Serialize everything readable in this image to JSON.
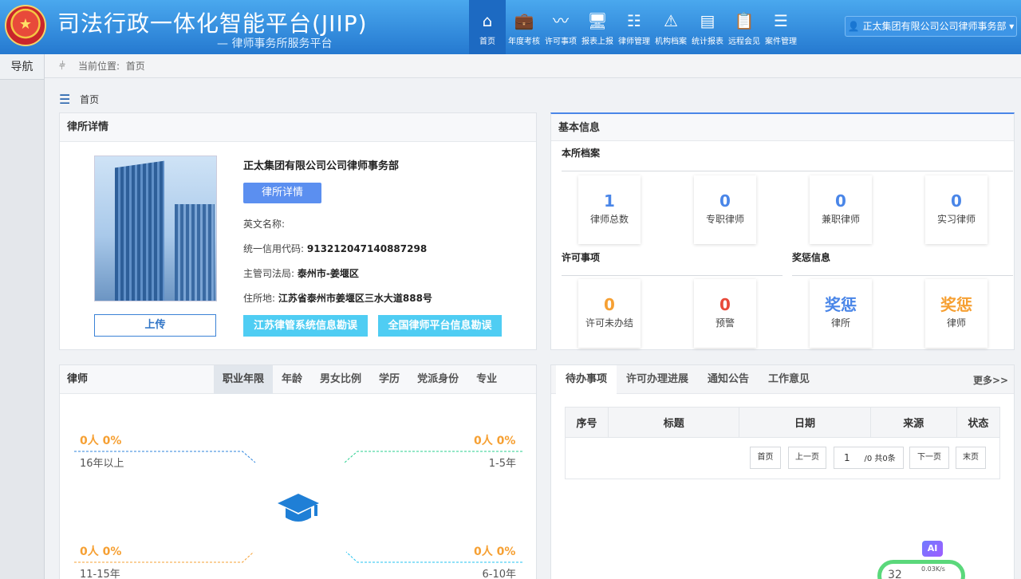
{
  "header": {
    "title": "司法行政一体化智能平台(JIIP)",
    "subtitle": "—  律师事务所服务平台",
    "nav": [
      {
        "label": "首页",
        "icon": "home-icon",
        "glyph": "⌂",
        "active": true
      },
      {
        "label": "年度考核",
        "icon": "briefcase-icon",
        "glyph": "💼"
      },
      {
        "label": "许可事项",
        "icon": "pulse-icon",
        "glyph": "〰"
      },
      {
        "label": "报表上报",
        "icon": "upload-screen-icon",
        "glyph": "🖥"
      },
      {
        "label": "律师管理",
        "icon": "org-chart-icon",
        "glyph": "☷"
      },
      {
        "label": "机构档案",
        "icon": "warning-icon",
        "glyph": "⚠"
      },
      {
        "label": "统计报表",
        "icon": "report-icon",
        "glyph": "▤"
      },
      {
        "label": "远程会见",
        "icon": "clipboard-icon",
        "glyph": "📋"
      },
      {
        "label": "案件管理",
        "icon": "list-user-icon",
        "glyph": "☰"
      }
    ],
    "user": "正太集团有限公司公司律师事务部"
  },
  "sidebar": {
    "title": "导航"
  },
  "breadcrumb": {
    "label": "当前位置:",
    "current": "首页"
  },
  "page_title": "首页",
  "firm_card": {
    "title": "律所详情",
    "name": "正太集团有限公司公司律师事务部",
    "detail_button": "律所详情",
    "english_name_label": "英文名称:",
    "english_name": "",
    "credit_code_label": "统一信用代码:",
    "credit_code": "913212047140887298",
    "bureau_label": "主管司法局:",
    "bureau": "泰州市-姜堰区",
    "address_label": "住所地:",
    "address": "江苏省泰州市姜堰区三水大道888号",
    "upload_button": "上传",
    "btn_js": "江苏律管系统信息勘误",
    "btn_nat": "全国律师平台信息勘误"
  },
  "basic_card": {
    "title": "基本信息",
    "archive_label": "本所档案",
    "archive_stats": [
      {
        "value": "1",
        "label": "律师总数"
      },
      {
        "value": "0",
        "label": "专职律师"
      },
      {
        "value": "0",
        "label": "兼职律师"
      },
      {
        "value": "0",
        "label": "实习律师"
      }
    ],
    "permit_label": "许可事项",
    "permit_stats": [
      {
        "value": "0",
        "label": "许可未办结",
        "color": "#f6a033"
      },
      {
        "value": "0",
        "label": "预警",
        "color": "#e84a3a"
      }
    ],
    "award_label": "奖惩信息",
    "award_stats": [
      {
        "value": "奖惩",
        "label": "律所",
        "color": "#4a86e8"
      },
      {
        "value": "奖惩",
        "label": "律师",
        "color": "#f6a033"
      }
    ]
  },
  "lawyer_card": {
    "title": "律师",
    "tabs": [
      "职业年限",
      "年龄",
      "男女比例",
      "学历",
      "党派身份",
      "专业"
    ],
    "active_tab": 0,
    "center_icon": "graduation-cap-icon"
  },
  "chart_data": {
    "type": "pie",
    "categories": [
      "1-5年",
      "6-10年",
      "11-15年",
      "16年以上"
    ],
    "values": [
      0,
      0,
      0,
      0
    ],
    "value_labels": [
      "0人 0%",
      "0人 0%",
      "0人 0%",
      "0人 0%"
    ],
    "colors": [
      "#27cf8f",
      "#21c3f0",
      "#f6a033",
      "#2f86de"
    ]
  },
  "todo_card": {
    "tabs": [
      "待办事项",
      "许可办理进展",
      "通知公告",
      "工作意见"
    ],
    "active_tab": 0,
    "more": "更多>>",
    "columns": [
      "序号",
      "标题",
      "日期",
      "来源",
      "状态"
    ],
    "pager": {
      "first": "首页",
      "prev": "上一页",
      "page": "1",
      "total": "/0 共0条",
      "next": "下一页",
      "last": "末页"
    }
  },
  "widget": {
    "ai": "AI",
    "percent": "32",
    "speed": "0.03K/s"
  }
}
